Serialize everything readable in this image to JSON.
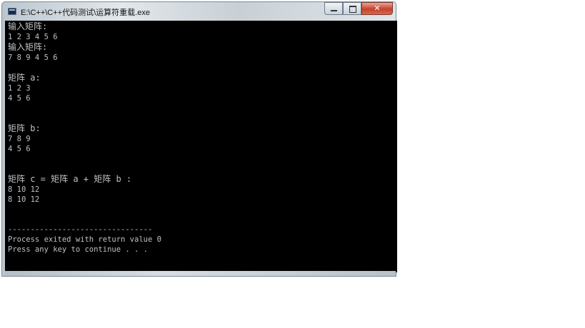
{
  "window": {
    "title": "E:\\C++\\C++代码测试\\运算符重载.exe"
  },
  "console": {
    "lines": [
      "输入矩阵:",
      "1 2 3 4 5 6",
      "输入矩阵:",
      "7 8 9 4 5 6",
      "",
      "矩阵 a:",
      "1 2 3",
      "4 5 6",
      "",
      "",
      "矩阵 b:",
      "7 8 9",
      "4 5 6",
      "",
      "",
      "矩阵 c = 矩阵 a + 矩阵 b :",
      "8 10 12",
      "8 10 12",
      "",
      "",
      "--------------------------------",
      "Process exited with return value 0",
      "Press any key to continue . . ."
    ]
  },
  "colors": {
    "console_bg": "#000000",
    "console_fg": "#c0c0c0"
  }
}
